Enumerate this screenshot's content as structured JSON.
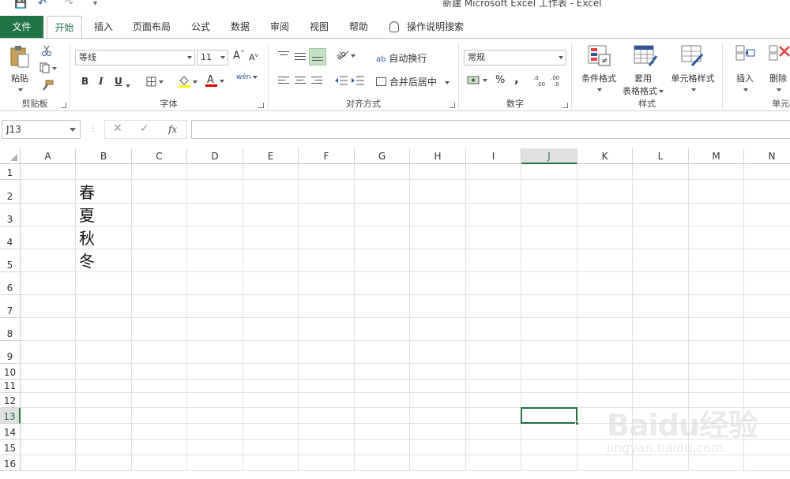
{
  "window": {
    "title": "新建 Microsoft Excel 工作表 - Excel"
  },
  "tabs": [
    {
      "label": "文件"
    },
    {
      "label": "开始"
    },
    {
      "label": "插入"
    },
    {
      "label": "页面布局"
    },
    {
      "label": "公式"
    },
    {
      "label": "数据"
    },
    {
      "label": "审阅"
    },
    {
      "label": "视图"
    },
    {
      "label": "帮助"
    }
  ],
  "tell_me": "操作说明搜索",
  "ribbon": {
    "clipboard": {
      "label": "剪贴板",
      "paste": "粘贴"
    },
    "font": {
      "label": "字体",
      "name": "等线",
      "size": "11",
      "bold": "B",
      "italic": "I",
      "underline": "U",
      "grow": "A",
      "shrink": "A",
      "color_a": "A",
      "wen": "wén"
    },
    "alignment": {
      "label": "对齐方式",
      "wrap": "自动换行",
      "merge": "合并后居中"
    },
    "number": {
      "label": "数字",
      "format": "常规",
      "percent": "%",
      "comma": ","
    },
    "styles": {
      "label": "样式",
      "conditional": "条件格式",
      "table_line1": "套用",
      "table_line2": "表格格式",
      "cell_styles": "单元格样式"
    },
    "cells": {
      "label": "单元格",
      "insert": "插入",
      "delete": "删除"
    }
  },
  "formula_bar": {
    "name_box": "J13",
    "cancel": "✕",
    "enter": "✓",
    "fx": "fx",
    "value": ""
  },
  "sheet": {
    "columns": [
      "A",
      "B",
      "C",
      "D",
      "E",
      "F",
      "G",
      "H",
      "I",
      "J",
      "K",
      "L",
      "M",
      "N"
    ],
    "rows": [
      "1",
      "2",
      "3",
      "4",
      "5",
      "6",
      "7",
      "8",
      "9",
      "10",
      "11",
      "12",
      "13",
      "14",
      "15",
      "16"
    ],
    "cells": [
      {
        "ref": "B2",
        "value": "春"
      },
      {
        "ref": "B3",
        "value": "夏"
      },
      {
        "ref": "B4",
        "value": "秋"
      },
      {
        "ref": "B5",
        "value": "冬"
      }
    ],
    "selected": "J13"
  },
  "watermark": {
    "line1": "Baidu经验",
    "line2": "jingyan.baidu.com"
  },
  "colors": {
    "accent": "#217346",
    "qa_icon": "#2b579a"
  }
}
